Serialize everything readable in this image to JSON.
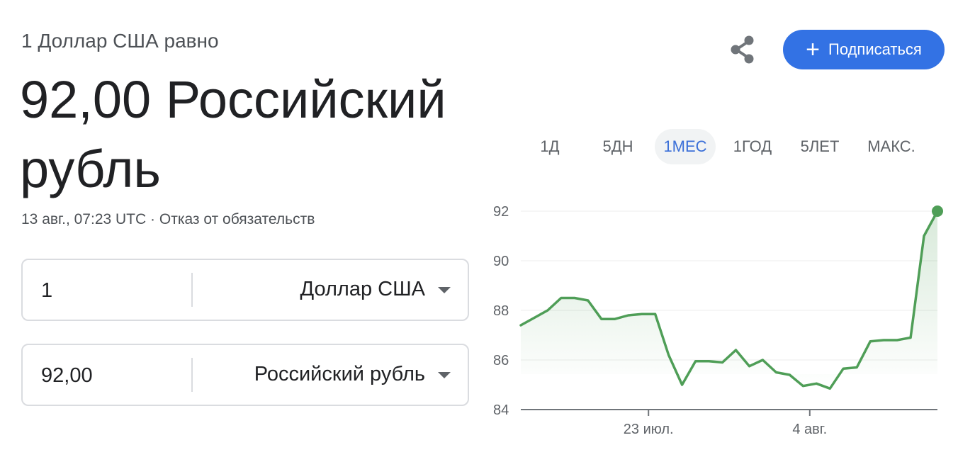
{
  "header": {
    "subtitle": "1 Доллар США равно",
    "result": "92,00 Российский рубль",
    "timestamp": "13 авг., 07:23 UTC",
    "separator": "·",
    "disclaimer": "Отказ от обязательств"
  },
  "actions": {
    "share_icon": "share-icon",
    "subscribe_label": "Подписаться",
    "subscribe_icon": "+",
    "subscribe_color": "#3372e4"
  },
  "converter": {
    "from": {
      "value": "1",
      "currency": "Доллар США"
    },
    "to": {
      "value": "92,00",
      "currency": "Российский рубль"
    }
  },
  "ranges": {
    "tabs": [
      "1Д",
      "5ДН",
      "1МЕС",
      "1ГОД",
      "5ЛЕТ",
      "МАКС."
    ],
    "active": "1МЕС"
  },
  "chart_data": {
    "type": "area",
    "line_color": "#4f9e57",
    "y_ticks": [
      84,
      86,
      88,
      90,
      92
    ],
    "ylim": [
      84,
      92
    ],
    "x_ticks": [
      {
        "label": "23 июл.",
        "index": 9.5
      },
      {
        "label": "4 авг.",
        "index": 21.5
      }
    ],
    "grid": true,
    "values": [
      87.4,
      87.7,
      88.0,
      88.5,
      88.5,
      88.4,
      87.65,
      87.65,
      87.8,
      87.85,
      87.85,
      86.2,
      85.0,
      85.95,
      85.95,
      85.9,
      86.4,
      85.75,
      86.0,
      85.5,
      85.4,
      84.95,
      85.05,
      84.85,
      85.65,
      85.7,
      86.75,
      86.8,
      86.8,
      86.9,
      91.0,
      92.0
    ]
  }
}
